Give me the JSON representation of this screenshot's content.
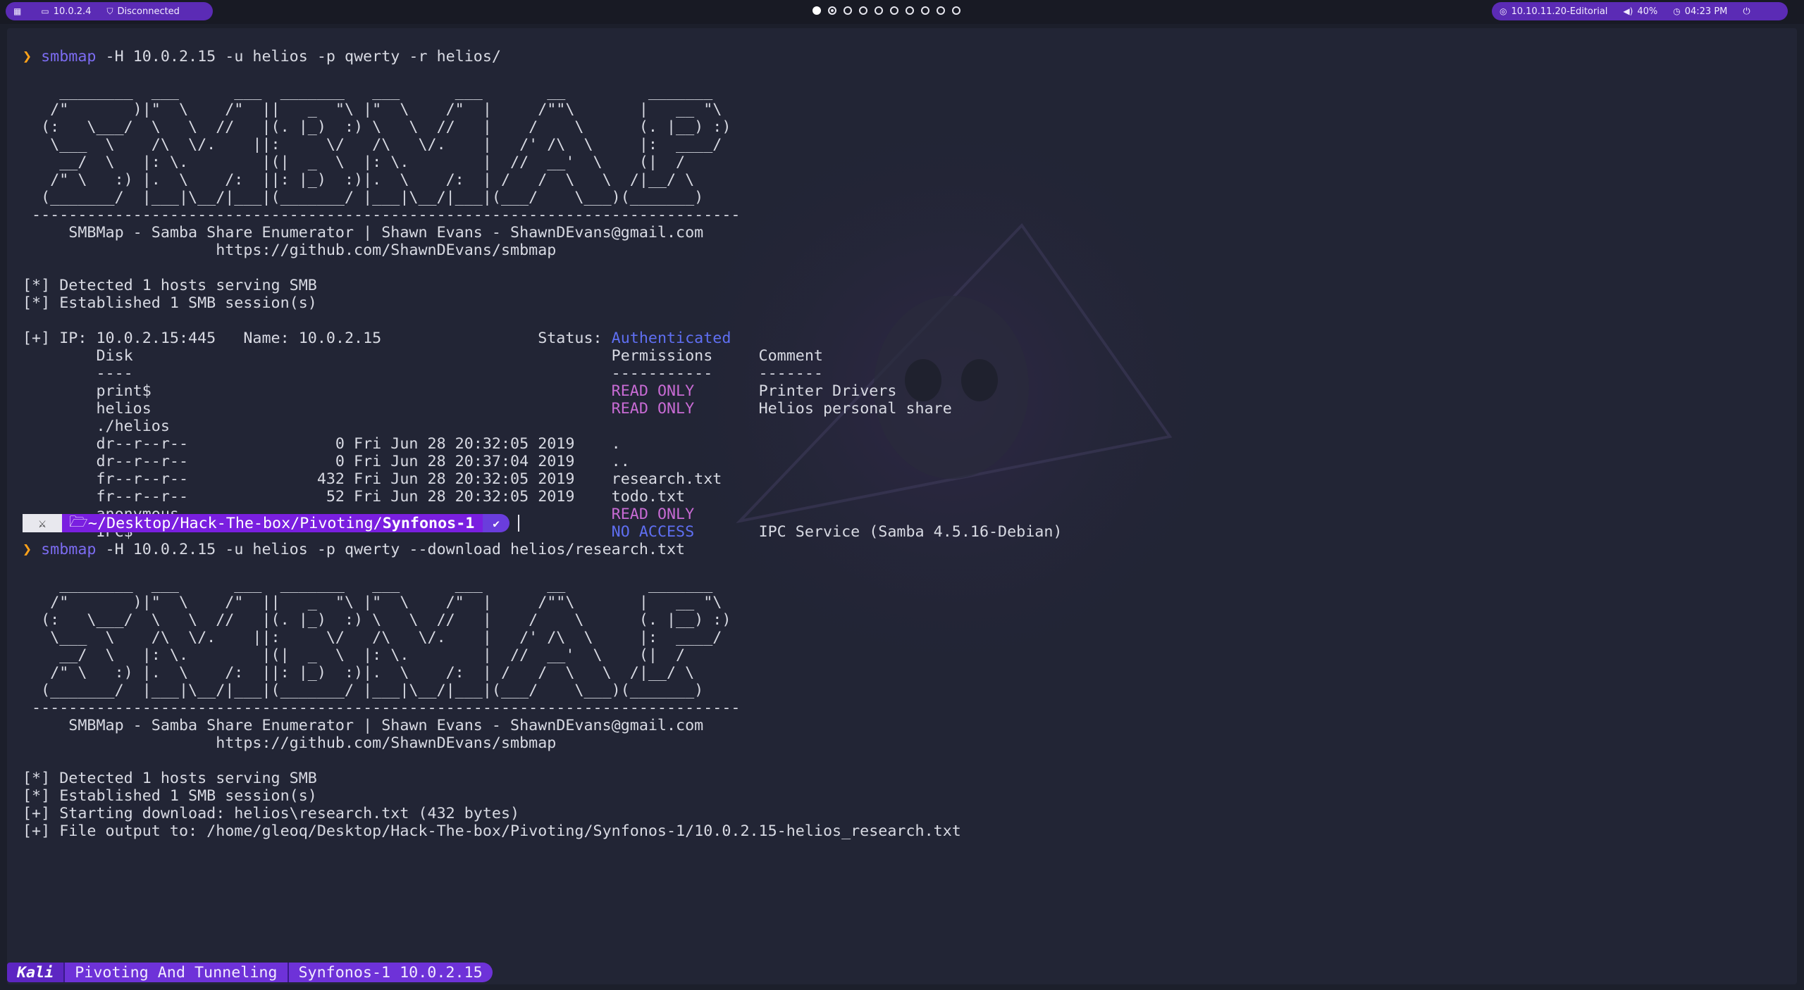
{
  "topbar": {
    "menu_icon": "grid-icon",
    "ip": "10.0.2.4",
    "vpn": "Disconnected",
    "target": "10.10.11.20-Editorial",
    "volume": "40%",
    "time": "04:23 PM",
    "workspaces": 10,
    "active_workspace": 1,
    "occupied_workspace": 2
  },
  "terminal": {
    "prompt_symbol": "❯",
    "lines": [
      {
        "spans": [
          {
            "t": "❯ ",
            "c": "amber"
          },
          {
            "t": "smbmap",
            "c": "purple"
          },
          {
            "t": " -H 10.0.2.15 -u helios -p qwerty -r helios/"
          }
        ]
      },
      {
        "spans": [
          {
            "t": ""
          }
        ]
      },
      {
        "spans": [
          {
            "t": "    ________  ___      ___  _______   ___      ___       __         _______"
          }
        ]
      },
      {
        "spans": [
          {
            "t": "   /\"       )|\"  \\    /\"  ||   _  \"\\ |\"  \\    /\"  |     /\"\"\\       |   __ \"\\"
          }
        ]
      },
      {
        "spans": [
          {
            "t": "  (:   \\___/  \\   \\  //   |(. |_)  :) \\   \\  //   |    /    \\      (. |__) :)"
          }
        ]
      },
      {
        "spans": [
          {
            "t": "   \\___  \\    /\\  \\/.    ||:     \\/   /\\   \\/.    |   /' /\\  \\     |:  ____/"
          }
        ]
      },
      {
        "spans": [
          {
            "t": "    __/  \\   |: \\.        |(|  _  \\  |: \\.        |  //  __'  \\    (|  /"
          }
        ]
      },
      {
        "spans": [
          {
            "t": "   /\" \\   :) |.  \\    /:  ||: |_)  :)|.  \\    /:  | /   /  \\   \\  /|__/ \\"
          }
        ]
      },
      {
        "spans": [
          {
            "t": "  (_______/  |___|\\__/|___|(_______/ |___|\\__/|___|(___/    \\___)(_______)"
          }
        ]
      },
      {
        "spans": [
          {
            "t": " -----------------------------------------------------------------------------"
          }
        ]
      },
      {
        "spans": [
          {
            "t": "     SMBMap - Samba Share Enumerator | Shawn Evans - ShawnDEvans@gmail.com"
          }
        ]
      },
      {
        "spans": [
          {
            "t": "                     https://github.com/ShawnDEvans/smbmap"
          }
        ]
      },
      {
        "spans": [
          {
            "t": ""
          }
        ]
      },
      {
        "spans": [
          {
            "t": "[*] Detected 1 hosts serving SMB"
          }
        ]
      },
      {
        "spans": [
          {
            "t": "[*] Established 1 SMB session(s)"
          }
        ]
      },
      {
        "spans": [
          {
            "t": ""
          }
        ]
      },
      {
        "spans": [
          {
            "t": "[+] IP: 10.0.2.15:445   Name: 10.0.2.15                 Status: "
          },
          {
            "t": "Authenticated",
            "c": "blue"
          }
        ]
      },
      {
        "spans": [
          {
            "t": "        Disk                                                    Permissions     Comment"
          }
        ]
      },
      {
        "spans": [
          {
            "t": "        ----                                                    -----------     -------"
          }
        ]
      },
      {
        "spans": [
          {
            "t": "        print$                                                  "
          },
          {
            "t": "READ ONLY",
            "c": "pink"
          },
          {
            "t": "       Printer Drivers"
          }
        ]
      },
      {
        "spans": [
          {
            "t": "        helios                                                  "
          },
          {
            "t": "READ ONLY",
            "c": "pink"
          },
          {
            "t": "       Helios personal share"
          }
        ]
      },
      {
        "spans": [
          {
            "t": "        ./helios"
          }
        ]
      },
      {
        "spans": [
          {
            "t": "        dr--r--r--                0 Fri Jun 28 20:32:05 2019    ."
          }
        ]
      },
      {
        "spans": [
          {
            "t": "        dr--r--r--                0 Fri Jun 28 20:37:04 2019    .."
          }
        ]
      },
      {
        "spans": [
          {
            "t": "        fr--r--r--              432 Fri Jun 28 20:32:05 2019    research.txt"
          }
        ]
      },
      {
        "spans": [
          {
            "t": "        fr--r--r--               52 Fri Jun 28 20:32:05 2019    todo.txt"
          }
        ]
      },
      {
        "spans": [
          {
            "t": "        anonymous                                               "
          },
          {
            "t": "READ ONLY",
            "c": "pink"
          }
        ]
      },
      {
        "spans": [
          {
            "t": "        IPC$                                                    "
          },
          {
            "t": "NO ACCESS",
            "c": "blue"
          },
          {
            "t": "       IPC Service (Samba 4.5.16-Debian)"
          }
        ]
      },
      {
        "spans": [
          {
            "t": "❯ ",
            "c": "amber"
          },
          {
            "t": "smbmap",
            "c": "purple"
          },
          {
            "t": " -H 10.0.2.15 -u helios -p qwerty --download helios/research.txt"
          }
        ]
      },
      {
        "spans": [
          {
            "t": ""
          }
        ]
      },
      {
        "spans": [
          {
            "t": "    ________  ___      ___  _______   ___      ___       __         _______"
          }
        ]
      },
      {
        "spans": [
          {
            "t": "   /\"       )|\"  \\    /\"  ||   _  \"\\ |\"  \\    /\"  |     /\"\"\\       |   __ \"\\"
          }
        ]
      },
      {
        "spans": [
          {
            "t": "  (:   \\___/  \\   \\  //   |(. |_)  :) \\   \\  //   |    /    \\      (. |__) :)"
          }
        ]
      },
      {
        "spans": [
          {
            "t": "   \\___  \\    /\\  \\/.    ||:     \\/   /\\   \\/.    |   /' /\\  \\     |:  ____/"
          }
        ]
      },
      {
        "spans": [
          {
            "t": "    __/  \\   |: \\.        |(|  _  \\  |: \\.        |  //  __'  \\    (|  /"
          }
        ]
      },
      {
        "spans": [
          {
            "t": "   /\" \\   :) |.  \\    /:  ||: |_)  :)|.  \\    /:  | /   /  \\   \\  /|__/ \\"
          }
        ]
      },
      {
        "spans": [
          {
            "t": "  (_______/  |___|\\__/|___|(_______/ |___|\\__/|___|(___/    \\___)(_______)"
          }
        ]
      },
      {
        "spans": [
          {
            "t": " -----------------------------------------------------------------------------"
          }
        ]
      },
      {
        "spans": [
          {
            "t": "     SMBMap - Samba Share Enumerator | Shawn Evans - ShawnDEvans@gmail.com"
          }
        ]
      },
      {
        "spans": [
          {
            "t": "                     https://github.com/ShawnDEvans/smbmap"
          }
        ]
      },
      {
        "spans": [
          {
            "t": ""
          }
        ]
      },
      {
        "spans": [
          {
            "t": "[*] Detected 1 hosts serving SMB"
          }
        ]
      },
      {
        "spans": [
          {
            "t": "[*] Established 1 SMB session(s)"
          }
        ]
      },
      {
        "spans": [
          {
            "t": "[+] Starting download: helios\\research.txt (432 bytes)"
          }
        ]
      },
      {
        "spans": [
          {
            "t": "[+] File output to: /home/gleoq/Desktop/Hack-The-box/Pivoting/Synfonos-1/10.0.2.15-helios_research.txt"
          }
        ]
      }
    ],
    "prompt": {
      "logo_icon": "kali-dragon-icon",
      "folder_icon": "folder-icon",
      "path_prefix": "~/Desktop/Hack-The-box/Pivoting/",
      "path_current": "Synfonos-1",
      "status_mark": "✔"
    }
  },
  "statusbar": {
    "session": "Kali",
    "tab1": "Pivoting And Tunneling",
    "tab2": "Synfonos-1 10.0.2.15"
  },
  "colors": {
    "accent": "#5b2bb5",
    "terminal_bg": "#222535",
    "command": "#7c6cf2",
    "read_only": "#c86bd4",
    "authenticated": "#5f6ff2",
    "prompt_arrow": "#ffa21a"
  }
}
